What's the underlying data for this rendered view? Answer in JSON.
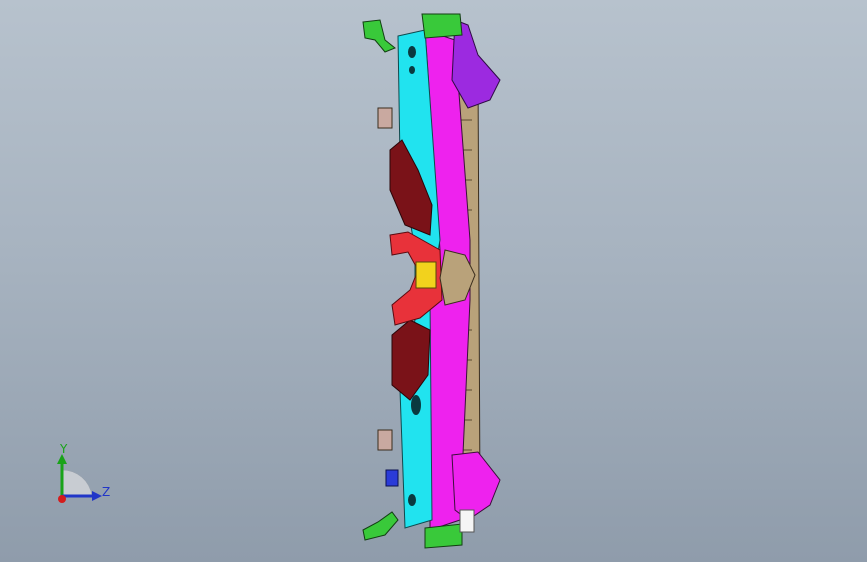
{
  "viewport": {
    "background_top": "#b7c2cd",
    "background_bottom": "#8f9cab"
  },
  "model": {
    "description_icon": "cad-assembly",
    "part_colors": {
      "cyan_rail": "#21e3ef",
      "magenta_rail": "#ee22ee",
      "purple_bracket": "#9c2ae0",
      "green_bracket": "#39c93a",
      "red_mount": "#e8323a",
      "dark_red": "#7a1218",
      "tan_frame": "#b9a27a",
      "yellow_part": "#f2d21d"
    }
  },
  "triad": {
    "y_label": "Y",
    "z_label": "Z",
    "y_color": "#19a319",
    "z_color": "#2136c8",
    "x_color": "#d41c1c"
  }
}
